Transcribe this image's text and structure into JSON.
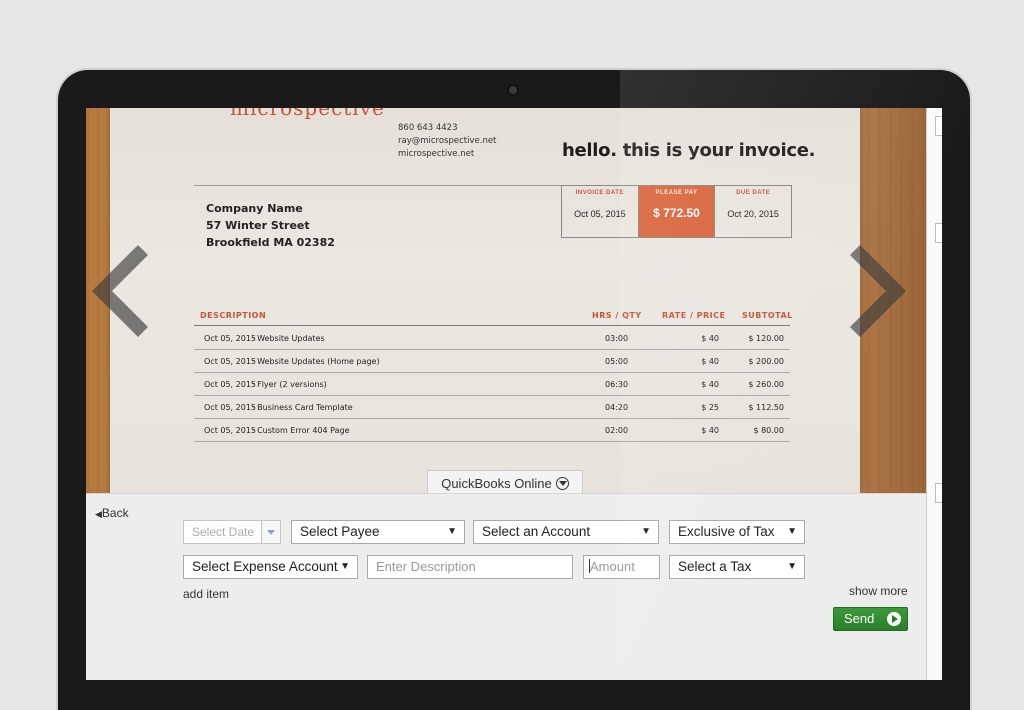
{
  "invoice": {
    "brand": "microspective",
    "contact": [
      "860 643 4423",
      "ray@microspective.net",
      "microspective.net"
    ],
    "headline": "hello. this is your invoice.",
    "address": [
      "Company Name",
      "57 Winter Street",
      "Brookfield MA 02382"
    ],
    "summary": {
      "invoice_date_label": "INVOICE DATE",
      "invoice_date": "Oct 05, 2015",
      "please_pay_label": "PLEASE PAY",
      "please_pay": "$ 772.50",
      "due_date_label": "DUE DATE",
      "due_date": "Oct 20, 2015"
    },
    "columns": {
      "description": "DESCRIPTION",
      "hrs": "HRS / QTY",
      "rate": "RATE / PRICE",
      "subtotal": "SUBTOTAL"
    },
    "rows": [
      {
        "date": "Oct 05, 2015",
        "desc": "· Website Updates",
        "hrs": "03:00",
        "rate": "$ 40",
        "subtotal": "$ 120.00"
      },
      {
        "date": "Oct 05, 2015",
        "desc": "· Website Updates (Home page)",
        "hrs": "05:00",
        "rate": "$ 40",
        "subtotal": "$ 200.00"
      },
      {
        "date": "Oct 05, 2015",
        "desc": "· Flyer (2 versions)",
        "hrs": "06:30",
        "rate": "$ 40",
        "subtotal": "$ 260.00"
      },
      {
        "date": "Oct 05, 2015",
        "desc": "· Business Card Template",
        "hrs": "04:20",
        "rate": "$ 25",
        "subtotal": "$ 112.50"
      },
      {
        "date": "Oct 05, 2015",
        "desc": "· Custom Error 404 Page",
        "hrs": "02:00",
        "rate": "$ 40",
        "subtotal": "$ 80.00"
      }
    ]
  },
  "qb_tab": "QuickBooks Online",
  "form": {
    "back": "Back",
    "select_date": "Select Date",
    "select_payee": "Select Payee",
    "select_account": "Select an Account",
    "tax_mode": "Exclusive of Tax",
    "expense_account": "Select Expense Account",
    "description_placeholder": "Enter Description",
    "amount_placeholder": "Amount",
    "select_tax": "Select a Tax",
    "add_item": "add item",
    "show_more": "show more",
    "send": "Send"
  },
  "colors": {
    "accent": "#c8543a",
    "pay_box": "#d9653d",
    "send_green": "#2b7f2b"
  },
  "icons": [
    "camera-icon",
    "prev-arrow-icon",
    "next-arrow-icon",
    "chevron-down-circle-icon",
    "back-caret-icon",
    "play-circle-icon"
  ]
}
